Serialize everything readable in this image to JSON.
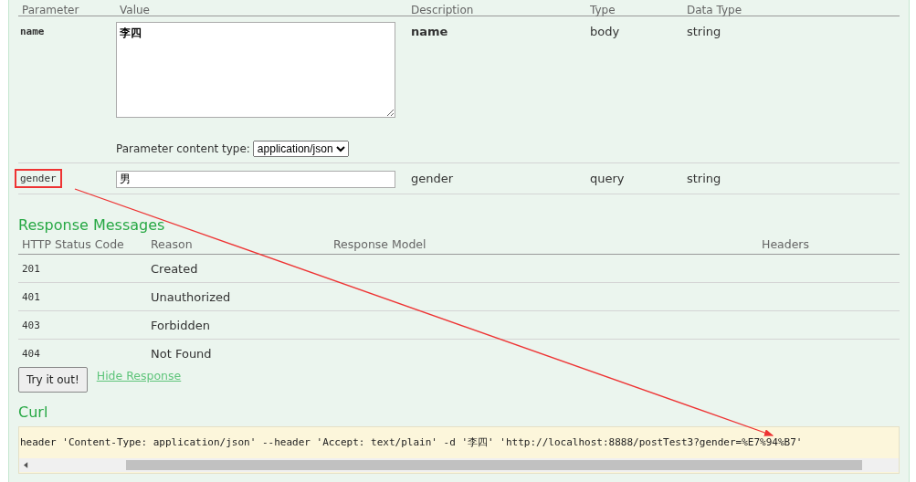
{
  "parameters": {
    "columns": [
      "Parameter",
      "Value",
      "Description",
      "Type",
      "Data Type"
    ],
    "rows": [
      {
        "kind": "textarea",
        "name": "name",
        "value": "李四",
        "description": "name",
        "param_type": "body",
        "data_type": "string",
        "content_type_label": "Parameter content type:",
        "content_type": "application/json",
        "highlighted": false
      },
      {
        "kind": "input",
        "name": "gender",
        "value": "男",
        "description": "gender",
        "param_type": "query",
        "data_type": "string",
        "highlighted": true
      }
    ]
  },
  "response_messages": {
    "title": "Response Messages",
    "columns": [
      "HTTP Status Code",
      "Reason",
      "Response Model",
      "Headers"
    ],
    "rows": [
      {
        "code": "201",
        "reason": "Created"
      },
      {
        "code": "401",
        "reason": "Unauthorized"
      },
      {
        "code": "403",
        "reason": "Forbidden"
      },
      {
        "code": "404",
        "reason": "Not Found"
      }
    ]
  },
  "try_button": "Try it out!",
  "hide_link": "Hide Response",
  "curl": {
    "title": "Curl",
    "command": "header 'Content-Type: application/json' --header 'Accept: text/plain' -d '李四' 'http://localhost:8888/postTest3?gender=%E7%94%B7'"
  }
}
